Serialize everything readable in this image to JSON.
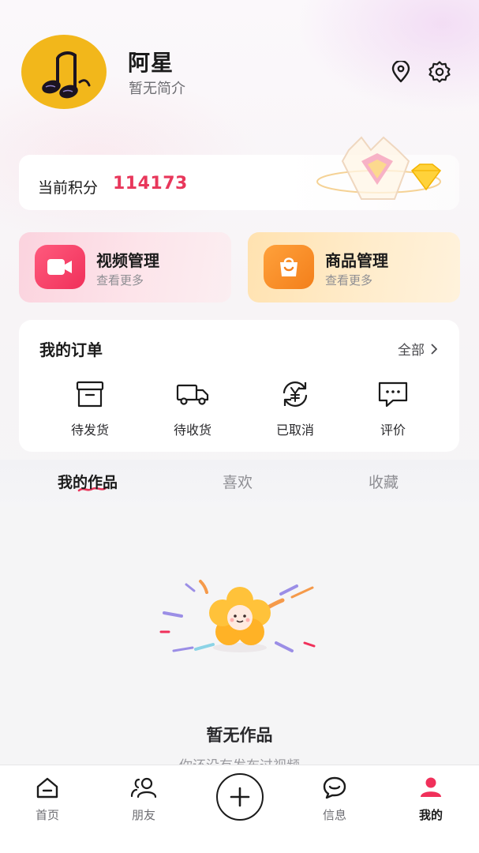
{
  "profile": {
    "name": "阿星",
    "bio": "暂无简介",
    "avatar_color": "#f2b71b"
  },
  "header_icons": [
    "location-icon",
    "gear-icon"
  ],
  "points": {
    "label": "当前积分",
    "value": "114173",
    "value_color": "#e8375b"
  },
  "management": [
    {
      "title": "视频管理",
      "subtitle": "查看更多",
      "icon": "video-camera-icon",
      "accent": "#f0305a"
    },
    {
      "title": "商品管理",
      "subtitle": "查看更多",
      "icon": "shopping-bag-icon",
      "accent": "#f37f1b"
    }
  ],
  "orders": {
    "title": "我的订单",
    "all_label": "全部",
    "items": [
      {
        "label": "待发货",
        "icon": "box-icon"
      },
      {
        "label": "待收货",
        "icon": "truck-icon"
      },
      {
        "label": "已取消",
        "icon": "yen-refresh-icon"
      },
      {
        "label": "评价",
        "icon": "comment-icon"
      }
    ]
  },
  "tabs": [
    {
      "label": "我的作品",
      "active": true
    },
    {
      "label": "喜欢",
      "active": false
    },
    {
      "label": "收藏",
      "active": false
    }
  ],
  "empty": {
    "title": "暂无作品",
    "subtitle": "你还没有发布过视频"
  },
  "nav": [
    {
      "label": "首页",
      "icon": "home-icon",
      "active": false
    },
    {
      "label": "朋友",
      "icon": "friends-icon",
      "active": false
    },
    {
      "label": "",
      "icon": "plus-icon",
      "active": false
    },
    {
      "label": "信息",
      "icon": "message-icon",
      "active": false
    },
    {
      "label": "我的",
      "icon": "user-icon",
      "active": true
    }
  ],
  "colors": {
    "active_accent": "#f0305a",
    "text_primary": "#1b1b1b"
  }
}
